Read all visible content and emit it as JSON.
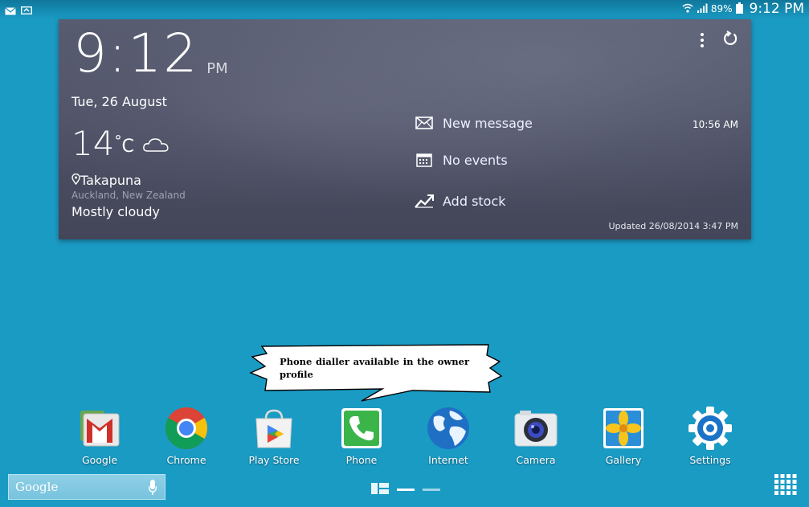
{
  "status_bar": {
    "battery": "89%",
    "time": "9:12 PM"
  },
  "widget": {
    "clock_time": "9:12",
    "clock_ampm": "PM",
    "date": "Tue, 26 August",
    "temperature": "14",
    "temp_unit": "C",
    "location": "Takapuna",
    "location_sub": "Auckland, New Zealand",
    "condition": "Mostly cloudy",
    "message_label": "New message",
    "message_time": "10:56 AM",
    "events_label": "No events",
    "stock_label": "Add stock",
    "updated": "Updated 26/08/2014 3:47 PM"
  },
  "callout": {
    "text": "Phone dialler available in the owner profile"
  },
  "dock": {
    "apps": [
      {
        "label": "Google",
        "icon": "google-folder-icon"
      },
      {
        "label": "Chrome",
        "icon": "chrome-icon"
      },
      {
        "label": "Play Store",
        "icon": "play-store-icon"
      },
      {
        "label": "Phone",
        "icon": "phone-icon"
      },
      {
        "label": "Internet",
        "icon": "globe-icon"
      },
      {
        "label": "Camera",
        "icon": "camera-icon"
      },
      {
        "label": "Gallery",
        "icon": "gallery-icon"
      },
      {
        "label": "Settings",
        "icon": "gear-icon"
      }
    ]
  },
  "google_bar": {
    "label": "Google"
  },
  "colors": {
    "wallpaper": "#1a9bc4",
    "widget_bg": "#4b4e62"
  }
}
